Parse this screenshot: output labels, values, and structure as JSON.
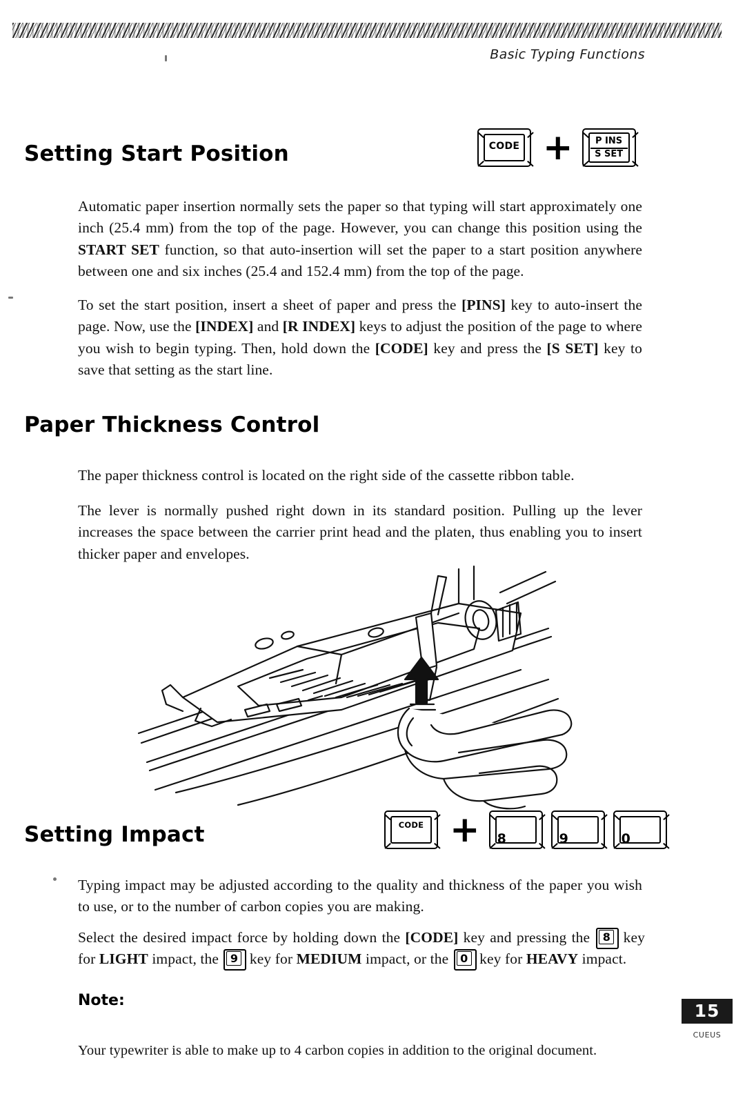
{
  "page": {
    "running_head": "Basic Typing Functions",
    "page_number": "15",
    "footer_code": "CUEUS"
  },
  "sections": [
    {
      "id": "setting-start-position",
      "title": "Setting Start Position",
      "key_illustration": {
        "keys": [
          {
            "type": "single",
            "label": "CODE"
          },
          {
            "type": "plus",
            "label": "+"
          },
          {
            "type": "dual",
            "label_top": "P INS",
            "label_bottom": "S SET"
          }
        ]
      },
      "paragraphs": [
        "Automatic paper insertion normally sets the paper so that typing will start approximately one inch (25.4 mm) from the top of the page. However, you can change this position using the START SET function, so that auto-insertion will set the paper to a start position anywhere between one and six inches (25.4 and 152.4 mm) from the top of the page.",
        "To set the start position, insert a sheet of paper and press the [PINS] key to auto-insert the page. Now, use the [INDEX] and [R INDEX] keys to adjust the position of the page to where you wish to begin typing. Then, hold down the [CODE] key and press the [S SET] key to save that setting as the start line."
      ]
    },
    {
      "id": "paper-thickness-control",
      "title": "Paper Thickness Control",
      "paragraphs": [
        "The paper thickness control is located on the right side of the cassette ribbon table.",
        "The lever is normally pushed right down in its standard position. Pulling up the lever increases the space between the carrier print head and the platen, thus enabling you to insert thicker paper and envelopes."
      ],
      "figure": "line-drawing of typewriter cassette ribbon table with a hand pulling up the paper thickness lever"
    },
    {
      "id": "setting-impact",
      "title": "Setting Impact",
      "key_illustration": {
        "keys": [
          {
            "type": "single",
            "label": "CODE"
          },
          {
            "type": "plus",
            "label": "+"
          },
          {
            "type": "number",
            "label": "8"
          },
          {
            "type": "number",
            "label": "9"
          },
          {
            "type": "number",
            "label": "0"
          }
        ]
      },
      "paragraphs": [
        "Typing impact may be adjusted according to the quality and thickness of the paper you wish to use, or to the number of carbon copies you are making."
      ],
      "impact_paragraph": {
        "part1": "Select the desired impact force by holding down the ",
        "code_key": "[CODE]",
        "part2": " key and pressing the ",
        "key_light": "8",
        "part3": " key for ",
        "light_label": "LIGHT",
        "part4": " impact, the ",
        "key_medium": "9",
        "part5": " key for ",
        "medium_label": "MEDIUM",
        "part6": " impact, or the ",
        "key_heavy": "0",
        "part7": " key for ",
        "heavy_label": "HEAVY",
        "part8": " impact."
      },
      "note_label": "Note:",
      "note_text": "Your typewriter is able to make up to 4 carbon copies in addition to the original document."
    }
  ]
}
